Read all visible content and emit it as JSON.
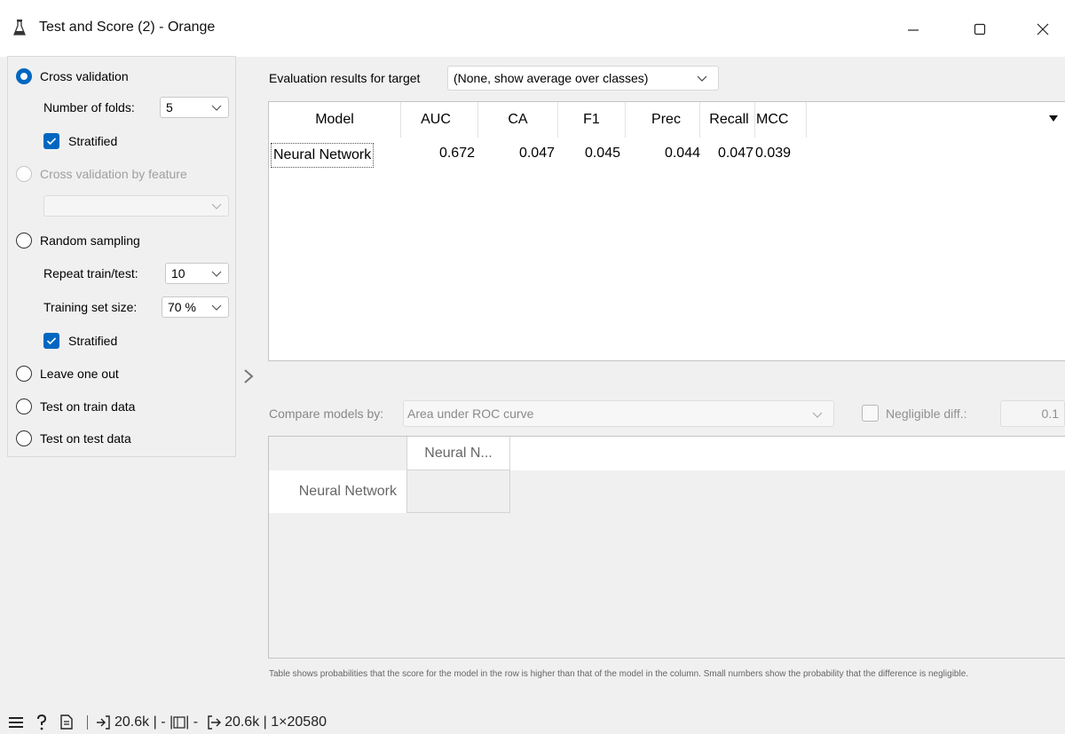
{
  "window": {
    "title": "Test and Score (2) - Orange",
    "controls": {
      "minimize": "—",
      "maximize": "☐",
      "close": "✕"
    }
  },
  "sampling": {
    "cross_validation": {
      "label": "Cross validation",
      "checked": true
    },
    "number_of_folds": {
      "label": "Number of folds:",
      "value": "5"
    },
    "cv_stratified": {
      "label": "Stratified",
      "checked": true
    },
    "cross_validation_by_feature": {
      "label": "Cross validation by feature",
      "enabled": false,
      "value": ""
    },
    "random_sampling": {
      "label": "Random sampling",
      "checked": false
    },
    "repeat_train_test": {
      "label": "Repeat train/test:",
      "value": "10"
    },
    "training_set_size": {
      "label": "Training set size:",
      "value": "70 %"
    },
    "rs_stratified": {
      "label": "Stratified",
      "checked": true
    },
    "leave_one_out": {
      "label": "Leave one out",
      "checked": false
    },
    "test_on_train": {
      "label": "Test on train data",
      "checked": false
    },
    "test_on_test": {
      "label": "Test on test data",
      "checked": false
    }
  },
  "evaluation": {
    "target_label": "Evaluation results for target",
    "target_value": "(None, show average over classes)",
    "columns": [
      "Model",
      "AUC",
      "CA",
      "F1",
      "Prec",
      "Recall",
      "MCC"
    ],
    "rows": [
      {
        "model": "Neural Network",
        "AUC": "0.672",
        "CA": "0.047",
        "F1": "0.045",
        "Prec": "0.044",
        "Recall": "0.047",
        "MCC": "0.039"
      }
    ]
  },
  "compare": {
    "label": "Compare models by:",
    "value": "Area under ROC curve",
    "negligible_label": "Negligible diff.:",
    "negligible_checked": false,
    "negligible_value": "0.1",
    "column_header": "Neural N...",
    "row_header": "Neural Network",
    "footnote": "Table shows probabilities that the score for the model in the row is higher than that of the model in the column. Small numbers show the probability that the difference is negligible."
  },
  "statusbar": {
    "input_summary": "20.6k | - | ",
    "input_tail": " | -",
    "output_summary": "20.6k | 1×20580"
  }
}
